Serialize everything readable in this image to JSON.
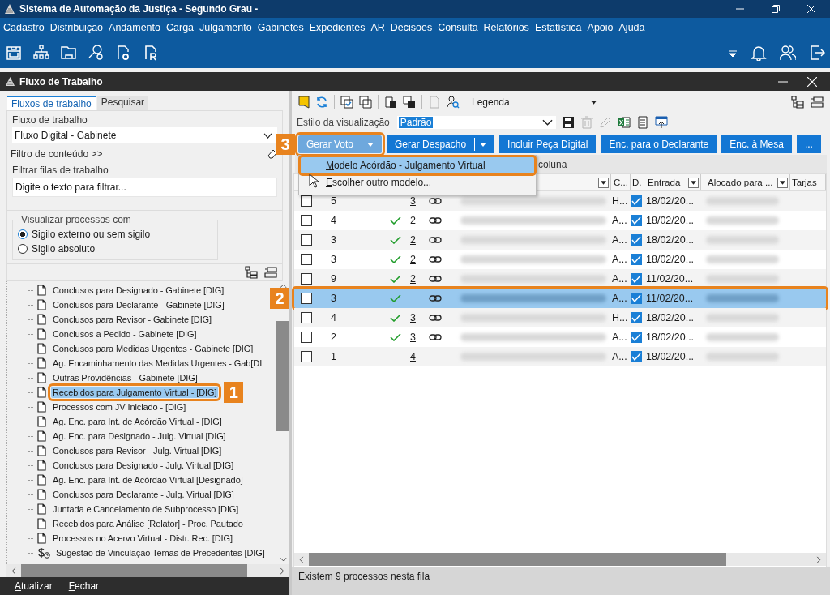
{
  "window": {
    "title": "Sistema de Automação da Justiça - Segundo Grau -"
  },
  "menu": [
    "Cadastro",
    "Distribuição",
    "Andamento",
    "Carga",
    "Julgamento",
    "Gabinetes",
    "Expedientes",
    "AR",
    "Decisões",
    "Consulta",
    "Relatórios",
    "Estatística",
    "Apoio",
    "Ajuda"
  ],
  "inner_window": {
    "title": "Fluxo de Trabalho"
  },
  "left_panel": {
    "tabs": [
      {
        "label": "Fluxos de trabalho",
        "selected": true
      },
      {
        "label": "Pesquisar",
        "selected": false
      }
    ],
    "workflow_label": "Fluxo de trabalho",
    "workflow_value": "Fluxo Digital - Gabinete",
    "content_filter_link": "Filtro de conteúdo >>",
    "queue_filter_label": "Filtrar filas de trabalho",
    "queue_filter": {
      "placeholder": "Digite o texto para filtrar..."
    },
    "visibility_group": {
      "title": "Visualizar processos com",
      "options": [
        {
          "label": "Sigilo externo ou sem sigilo",
          "selected": true
        },
        {
          "label": "Sigilo absoluto",
          "selected": false
        }
      ]
    },
    "queues": [
      {
        "label": "Conclusos para Designado - Gabinete [DIG]",
        "kind": "document",
        "selected": false
      },
      {
        "label": "Conclusos para Declarante - Gabinete [DIG]",
        "kind": "document",
        "selected": false
      },
      {
        "label": "Conclusos para Revisor - Gabinete [DIG]",
        "kind": "document",
        "selected": false
      },
      {
        "label": "Conclusos a Pedido - Gabinete [DIG]",
        "kind": "document",
        "selected": false
      },
      {
        "label": "Conclusos para Medidas Urgentes - Gabinete [DIG]",
        "kind": "document",
        "selected": false
      },
      {
        "label": "Ag. Encaminhamento das Medidas Urgentes - Gab[DI",
        "kind": "document",
        "selected": false
      },
      {
        "label": "Outras Providências - Gabinete [DIG]",
        "kind": "document",
        "selected": false
      },
      {
        "label": "Recebidos para Julgamento Virtual - [DIG]",
        "kind": "document",
        "selected": true,
        "callout": "1"
      },
      {
        "label": "Processos com JV Iniciado - [DIG]",
        "kind": "document",
        "selected": false
      },
      {
        "label": "Ag. Enc. para Int. de Acórdão Virtual - [DIG]",
        "kind": "document",
        "selected": false
      },
      {
        "label": "Ag. Enc. para Designado - Julg. Virtual [DIG]",
        "kind": "document",
        "selected": false
      },
      {
        "label": "Conclusos para Revisor - Julg. Virtual [DIG]",
        "kind": "document",
        "selected": false
      },
      {
        "label": "Conclusos para Designado - Julg. Virtual [DIG]",
        "kind": "document",
        "selected": false
      },
      {
        "label": "Ag. Enc. para Int. de Acórdão Virtual [Designado]",
        "kind": "document",
        "selected": false
      },
      {
        "label": "Conclusos para Declarante - Julg. Virtual [DIG]",
        "kind": "document",
        "selected": false
      },
      {
        "label": "Juntada e Cancelamento de Subprocesso [DIG]",
        "kind": "document",
        "selected": false
      },
      {
        "label": "Recebidos para Análise [Relator] - Proc. Pautado",
        "kind": "document",
        "selected": false
      },
      {
        "label": "Processos no Acervo Virtual - Distr. Rec. [DIG]",
        "kind": "document",
        "selected": false
      },
      {
        "label": "Sugestão de Vinculação Temas de Precedentes [DIG]",
        "kind": "money-clock",
        "selected": false
      }
    ],
    "actions": [
      "Atualizar",
      "Fechar"
    ]
  },
  "right_panel": {
    "legend": "Legenda",
    "view_style_label": "Estilo da visualização",
    "view_style_value": "Padrão",
    "buttons": [
      {
        "label": "Gerar Voto",
        "kind": "split",
        "open": true,
        "callout": "3"
      },
      {
        "label": "Gerar Despacho",
        "kind": "split",
        "open": false
      },
      {
        "label": "Incluir Peça Digital",
        "kind": "plain",
        "open": false
      },
      {
        "label": "Enc. para o Declarante",
        "kind": "plain",
        "open": false
      },
      {
        "label": "Enc. à Mesa",
        "kind": "plain",
        "open": false
      },
      {
        "label": "...",
        "kind": "plain",
        "open": false
      }
    ],
    "dropdown_menu": [
      {
        "label": "Modelo Acórdão - Julgamento Virtual",
        "selected": true
      },
      {
        "label": "Escolher outro modelo...",
        "selected": false
      }
    ],
    "group_panel_hint": "coluna",
    "columns": [
      {
        "label": "C...",
        "filter": false
      },
      {
        "label": "D.",
        "filter": false
      },
      {
        "label": "Entrada",
        "filter": true
      },
      {
        "label": "Alocado para ...",
        "filter": true
      },
      {
        "label": "Tarjas",
        "filter": false
      }
    ],
    "rows": [
      {
        "checked": false,
        "column_2": "5",
        "ok": false,
        "link": "3",
        "linked": true,
        "c": "H...",
        "d": true,
        "entrada": "18/02/20...",
        "selected": false
      },
      {
        "checked": false,
        "column_2": "4",
        "ok": true,
        "link": "2",
        "linked": true,
        "c": "A...",
        "d": true,
        "entrada": "18/02/20...",
        "selected": false
      },
      {
        "checked": false,
        "column_2": "3",
        "ok": true,
        "link": "2",
        "linked": true,
        "c": "A...",
        "d": true,
        "entrada": "18/02/20...",
        "selected": false
      },
      {
        "checked": false,
        "column_2": "3",
        "ok": true,
        "link": "2",
        "linked": true,
        "c": "A...",
        "d": true,
        "entrada": "18/02/20...",
        "selected": false
      },
      {
        "checked": false,
        "column_2": "9",
        "ok": true,
        "link": "2",
        "linked": true,
        "c": "A...",
        "d": true,
        "entrada": "11/02/20...",
        "selected": false
      },
      {
        "checked": false,
        "column_2": "3",
        "ok": true,
        "linked": true,
        "c": "A...",
        "d": true,
        "entrada": "11/02/20...",
        "selected": true,
        "callout": "2"
      },
      {
        "checked": false,
        "column_2": "4",
        "ok": true,
        "link": "3",
        "linked": true,
        "c": "H...",
        "d": true,
        "entrada": "18/02/20...",
        "selected": false
      },
      {
        "checked": false,
        "column_2": "2",
        "ok": true,
        "link": "3",
        "linked": true,
        "c": "A...",
        "d": true,
        "entrada": "18/02/20...",
        "selected": false
      },
      {
        "checked": false,
        "column_2": "1",
        "ok": false,
        "link": "4",
        "linked": false,
        "c": "A...",
        "d": true,
        "entrada": "18/02/20...",
        "selected": false
      }
    ],
    "status": "Existem 9 processos nesta fila"
  }
}
